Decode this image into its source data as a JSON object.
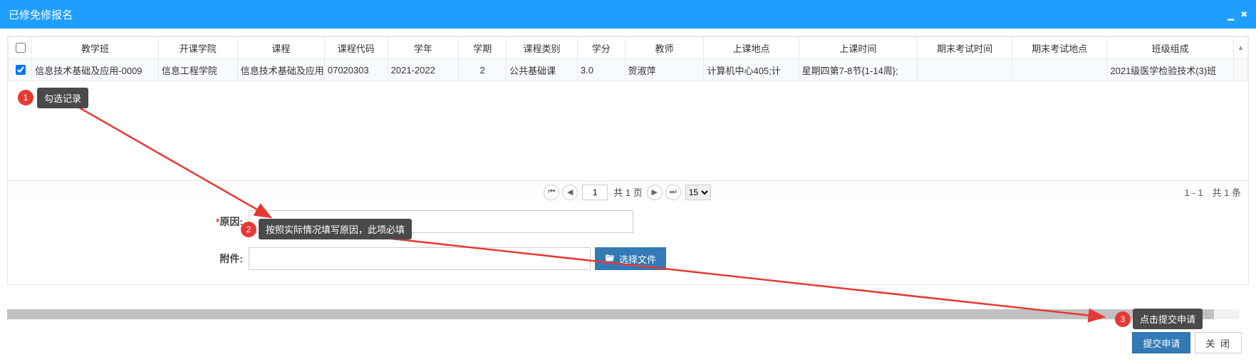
{
  "header": {
    "title": "已修免修报名",
    "minimize_icon": "minimize-icon",
    "close_icon": "close-icon"
  },
  "table": {
    "headers": {
      "class": "教学班",
      "dept": "开课学院",
      "course": "课程",
      "code": "课程代码",
      "year": "学年",
      "term": "学期",
      "category": "课程类别",
      "credit": "学分",
      "teacher": "教师",
      "place": "上课地点",
      "time": "上课时间",
      "exam_time": "期末考试时间",
      "exam_place": "期末考试地点",
      "group": "班级组成"
    },
    "row": {
      "class": "信息技术基础及应用-0009",
      "dept": "信息工程学院",
      "course": "信息技术基础及应用",
      "code": "07020303",
      "year": "2021-2022",
      "term": "2",
      "category": "公共基础课",
      "credit": "3.0",
      "teacher": "贺淑萍",
      "place": "计算机中心405;计",
      "time": "星期四第7-8节{1-14周};",
      "exam_time": "",
      "exam_place": "",
      "group": "2021级医学检验技术(3)班"
    }
  },
  "pagination": {
    "page_value": "1",
    "total_pages_text": "共 1 页",
    "page_size": "15",
    "info": "1 - 1　共 1 条"
  },
  "form": {
    "reason_label": "原因:",
    "attachment_label": "附件:",
    "choose_file_btn": "选择文件"
  },
  "buttons": {
    "submit": "提交申请",
    "close": "关 闭"
  },
  "annotations": {
    "a1_num": "1",
    "a1_text": "勾选记录",
    "a2_num": "2",
    "a2_text": "按照实际情况填写原因，此项必填",
    "a3_num": "3",
    "a3_text": "点击提交申请"
  }
}
